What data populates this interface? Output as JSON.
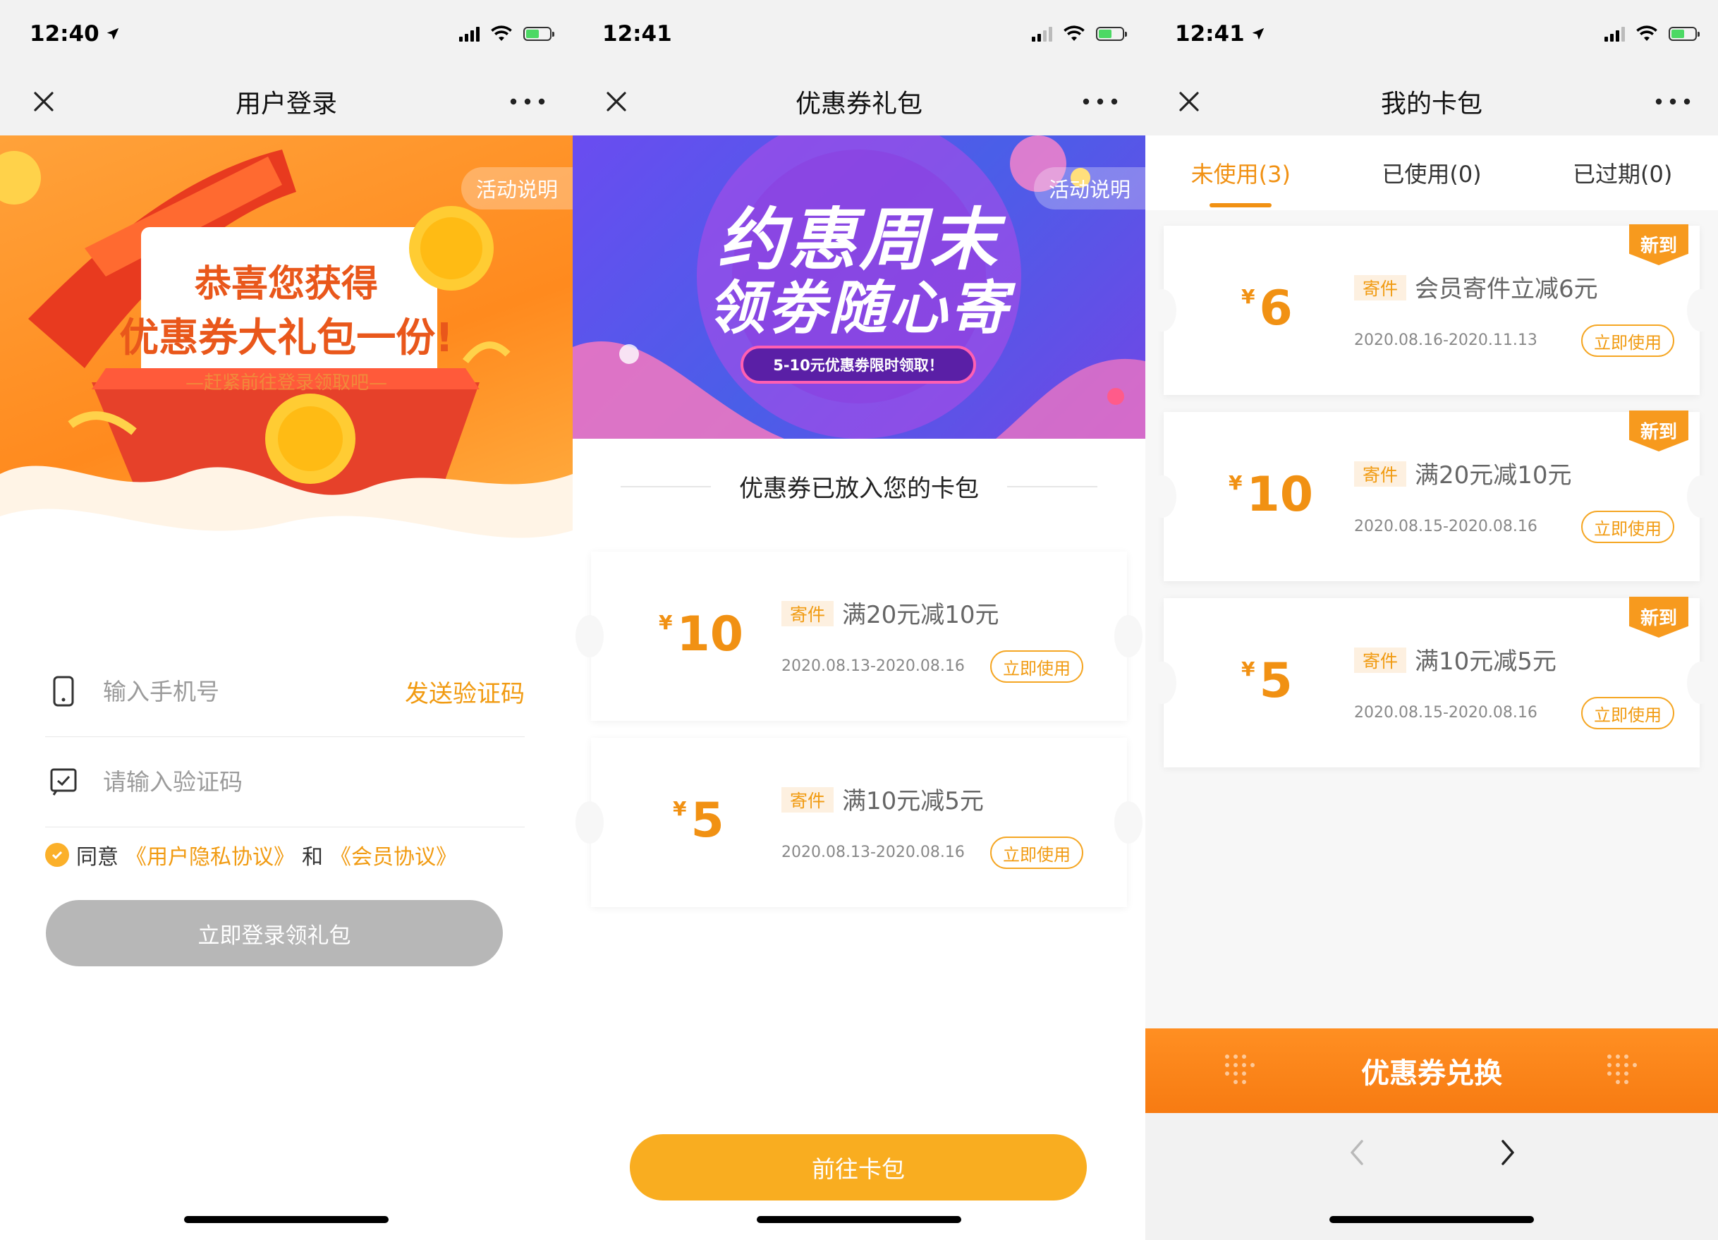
{
  "screens": [
    {
      "status": {
        "time": "12:40",
        "location_arrow": true
      },
      "nav": {
        "title": "用户登录"
      },
      "activity_label": "活动说明",
      "banner": {
        "line1": "恭喜您获得",
        "line2": "优惠券大礼包一份!",
        "sub": "—赶紧前往登录领取吧—"
      },
      "phone": {
        "placeholder": "输入手机号",
        "send_code": "发送验证码"
      },
      "code": {
        "placeholder": "请输入验证码"
      },
      "agree": {
        "prefix": "同意",
        "privacy": "《用户隐私协议》",
        "and": "和",
        "member": "《会员协议》"
      },
      "login_button": "立即登录领礼包"
    },
    {
      "status": {
        "time": "12:41",
        "location_arrow": false
      },
      "nav": {
        "title": "优惠券礼包"
      },
      "activity_label": "活动说明",
      "banner": {
        "line1": "约惠周末",
        "line2": "领劵随心寄",
        "ribbon": "5-10元优惠劵限时领取！"
      },
      "section_title": "优惠券已放入您的卡包",
      "coupons": [
        {
          "currency": "¥",
          "amount": "10",
          "tag": "寄件",
          "title": "满20元减10元",
          "date": "2020.08.13-2020.08.16",
          "use": "立即使用"
        },
        {
          "currency": "¥",
          "amount": "5",
          "tag": "寄件",
          "title": "满10元减5元",
          "date": "2020.08.13-2020.08.16",
          "use": "立即使用"
        }
      ],
      "goto_button": "前往卡包"
    },
    {
      "status": {
        "time": "12:41",
        "location_arrow": true
      },
      "nav": {
        "title": "我的卡包"
      },
      "tabs": [
        {
          "label": "未使用(3)",
          "active": true
        },
        {
          "label": "已使用(0)",
          "active": false
        },
        {
          "label": "已过期(0)",
          "active": false
        }
      ],
      "coupons": [
        {
          "badge": "新到",
          "currency": "¥",
          "amount": "6",
          "tag": "寄件",
          "title": "会员寄件立减6元",
          "date": "2020.08.16-2020.11.13",
          "use": "立即使用"
        },
        {
          "badge": "新到",
          "currency": "¥",
          "amount": "10",
          "tag": "寄件",
          "title": "满20元减10元",
          "date": "2020.08.15-2020.08.16",
          "use": "立即使用"
        },
        {
          "badge": "新到",
          "currency": "¥",
          "amount": "5",
          "tag": "寄件",
          "title": "满10元减5元",
          "date": "2020.08.15-2020.08.16",
          "use": "立即使用"
        }
      ],
      "exchange_label": "优惠券兑换"
    }
  ],
  "colors": {
    "accent": "#f19113",
    "button_gray": "#b7b7b7",
    "button_yellow": "#f9ad20",
    "banner_orange": "#ff8a1e",
    "banner_purple": "#5a52ea"
  },
  "icons": [
    "close-icon",
    "more-icon",
    "location-arrow-icon",
    "signal-icon",
    "wifi-icon",
    "battery-icon",
    "phone-icon",
    "sms-icon",
    "check-icon",
    "chevron-left-icon",
    "chevron-right-icon"
  ]
}
